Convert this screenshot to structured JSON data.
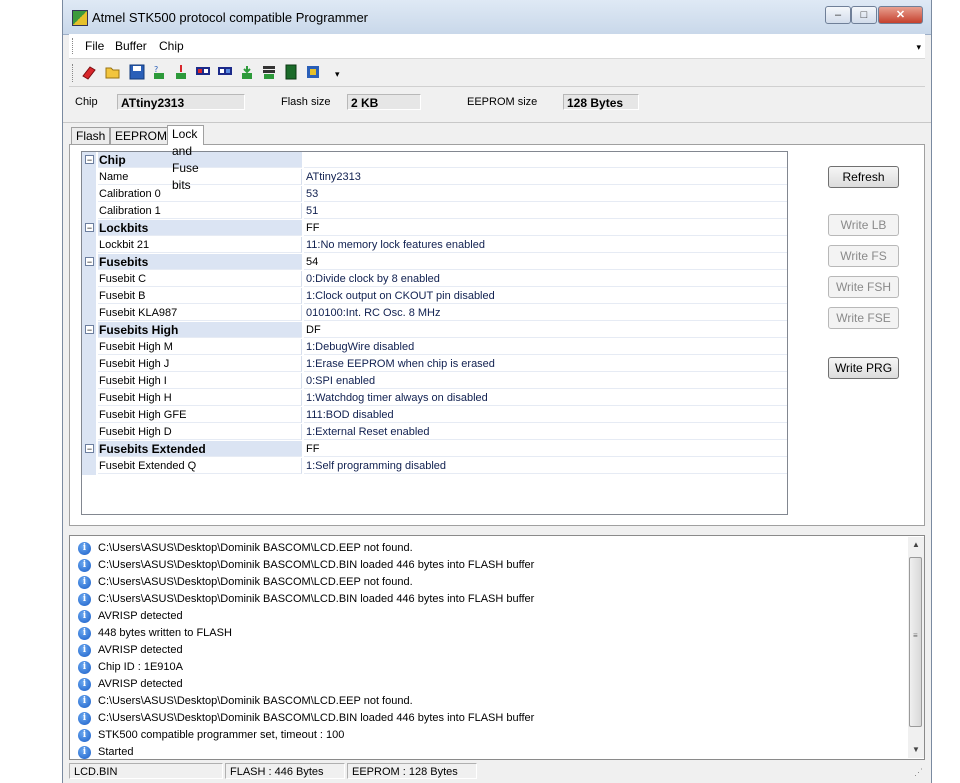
{
  "window": {
    "title": "Atmel STK500 protocol compatible Programmer",
    "min_label": "‒",
    "max_label": "□",
    "close_label": "✕"
  },
  "menu": {
    "file": "File",
    "buffer": "Buffer",
    "chip": "Chip",
    "more": "▾"
  },
  "toolbar": {
    "icons": [
      "erase-icon",
      "open-icon",
      "save-icon",
      "verify-icon",
      "write-icon",
      "write-flash-icon",
      "read-flash-icon",
      "write-eeprom-icon",
      "read-eeprom-icon",
      "program-icon",
      "chip-icon"
    ],
    "more": "▾"
  },
  "chipinfo": {
    "chip_label": "Chip",
    "chip_value": "ATtiny2313",
    "flash_label": "Flash size",
    "flash_value": "2 KB",
    "eeprom_label": "EEPROM size",
    "eeprom_value": "128 Bytes"
  },
  "tabs": [
    "Flash",
    "EEPROM",
    "Lock and Fuse bits"
  ],
  "grid": {
    "rows": [
      {
        "type": "cat",
        "name": "Chip",
        "value": ""
      },
      {
        "type": "item",
        "name": "Name",
        "value": "ATtiny2313"
      },
      {
        "type": "item",
        "name": "Calibration 0",
        "value": "53"
      },
      {
        "type": "item",
        "name": "Calibration 1",
        "value": "51"
      },
      {
        "type": "cat",
        "name": "Lockbits",
        "value": "FF"
      },
      {
        "type": "item",
        "name": "Lockbit 21",
        "value": "11:No memory lock features enabled"
      },
      {
        "type": "cat",
        "name": "Fusebits",
        "value": "54"
      },
      {
        "type": "item",
        "name": "Fusebit C",
        "value": "0:Divide clock by 8 enabled"
      },
      {
        "type": "item",
        "name": "Fusebit B",
        "value": "1:Clock output on CKOUT pin disabled"
      },
      {
        "type": "item",
        "name": "Fusebit KLA987",
        "value": "010100:Int. RC Osc. 8 MHz"
      },
      {
        "type": "cat",
        "name": "Fusebits High",
        "value": "DF"
      },
      {
        "type": "item",
        "name": "Fusebit High M",
        "value": "1:DebugWire disabled"
      },
      {
        "type": "item",
        "name": "Fusebit High J",
        "value": "1:Erase EEPROM when chip is erased"
      },
      {
        "type": "item",
        "name": "Fusebit High I",
        "value": "0:SPI enabled"
      },
      {
        "type": "item",
        "name": "Fusebit High H",
        "value": "1:Watchdog timer always on disabled"
      },
      {
        "type": "item",
        "name": "Fusebit High GFE",
        "value": "111:BOD disabled"
      },
      {
        "type": "item",
        "name": "Fusebit High D",
        "value": "1:External Reset enabled"
      },
      {
        "type": "cat",
        "name": "Fusebits Extended",
        "value": "FF"
      },
      {
        "type": "item",
        "name": "Fusebit Extended Q",
        "value": "1:Self programming disabled"
      }
    ],
    "toggle": "−"
  },
  "buttons": {
    "refresh": "Refresh",
    "write_lb": "Write LB",
    "write_fs": "Write FS",
    "write_fsh": "Write FSH",
    "write_fse": "Write FSE",
    "write_prg": "Write PRG"
  },
  "log": [
    "C:\\Users\\ASUS\\Desktop\\Dominik BASCOM\\LCD.EEP not found.",
    "C:\\Users\\ASUS\\Desktop\\Dominik BASCOM\\LCD.BIN loaded 446 bytes into FLASH buffer",
    "C:\\Users\\ASUS\\Desktop\\Dominik BASCOM\\LCD.EEP not found.",
    "C:\\Users\\ASUS\\Desktop\\Dominik BASCOM\\LCD.BIN loaded 446 bytes into FLASH buffer",
    "AVRISP detected",
    "448 bytes written to FLASH",
    "AVRISP detected",
    "Chip ID : 1E910A",
    "AVRISP detected",
    "C:\\Users\\ASUS\\Desktop\\Dominik BASCOM\\LCD.EEP not found.",
    "C:\\Users\\ASUS\\Desktop\\Dominik BASCOM\\LCD.BIN loaded 446 bytes into FLASH buffer",
    "STK500 compatible programmer set, timeout : 100",
    "Started"
  ],
  "log_icon": "i",
  "scrollbar": {
    "up": "▲",
    "down": "▼",
    "grip": "≡"
  },
  "status": {
    "file": "LCD.BIN",
    "flash": "FLASH : 446 Bytes",
    "eeprom": "EEPROM : 128 Bytes",
    "resize": "⋰"
  }
}
